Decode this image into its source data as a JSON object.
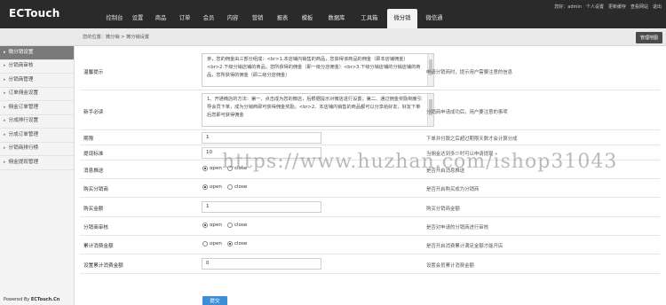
{
  "app": {
    "logo": "ECTouch"
  },
  "nav": {
    "items": [
      "控制台",
      "设置",
      "商品",
      "订单",
      "会员",
      "内容",
      "营销",
      "报表",
      "模板",
      "数据库",
      "工具箱",
      "微分销",
      "微信通"
    ],
    "active_index": 11
  },
  "user_links": [
    "您好：admin",
    "个人设置",
    "更新缓存",
    "查看网站",
    "退出"
  ],
  "breadcrumb": "您的位置：微分销 > 微分销设置",
  "manage_button": "管理地图",
  "sidebar": {
    "items": [
      "微分销设置",
      "分销商审核",
      "分销商管理",
      "订单佣金设置",
      "佣金订单管理",
      "分成排行设置",
      "分成订单管理",
      "分销商排行榜",
      "佣金提现管理"
    ],
    "active_index": 0
  },
  "powered_by": {
    "prefix": "Powered By ",
    "brand": "ECTouch.Cn"
  },
  "form": {
    "notice": {
      "label": "温馨提示",
      "text": "亲，您的佣金由三部分组成：<br>1.本店铺内销售的商品，您获得该商品的佣金（即本店铺佣金）<br>2.下级分销店铺的商品，您所获得的佣金（即一级分店佣金）<br>3.下级分销店铺的分销店铺的商品，您所获得的佣金（即二级分店佣金）",
      "note": "申请分销商时，提示用户需要注意的信息"
    },
    "novice": {
      "label": "新手必读",
      "text": "1、开通微店的方法：第一、点击成为您的微店，后根据提示对微店进行设置；第二、通过佣金奖励制度引导会员下单，成为分销商即可获得佣金奖励。<br>2、本店铺内销售的商品都可以分享给好友，好友下单后您即可获得佣金",
      "note": "分销商申请成功后，用户要注意的事项"
    },
    "period": {
      "label": "期限",
      "value": "1",
      "note": "下单并付款之后超过期限天数才会计算分成"
    },
    "threshold": {
      "label": "提现标准",
      "value": "10",
      "note": "当佣金达到多少时可以申请提现"
    },
    "push": {
      "label": "消息推送",
      "options": [
        "open",
        "close"
      ],
      "selected": 0,
      "note": "是否开启消息推送"
    },
    "buy_become": {
      "label": "购买分销商",
      "options": [
        "open",
        "close"
      ],
      "selected": 0,
      "note": "是否开启购买成为分销商"
    },
    "buy_amount": {
      "label": "购买金额",
      "value": "1",
      "note": "购买分销商金额"
    },
    "audit": {
      "label": "分销商审核",
      "options": [
        "open",
        "close"
      ],
      "selected": 0,
      "note": "是否对申请的分销商进行审核"
    },
    "cumulative": {
      "label": "累计消费金额",
      "options": [
        "open",
        "close"
      ],
      "selected": 1,
      "note": "是否开启消费累计满足金额才能开店"
    },
    "set_amount": {
      "label": "设置累计消费金额",
      "value": "0",
      "note": "设置会员累计消费金额"
    },
    "submit": "提交"
  },
  "watermark": "https://www.huzhan.com/ishop31043"
}
